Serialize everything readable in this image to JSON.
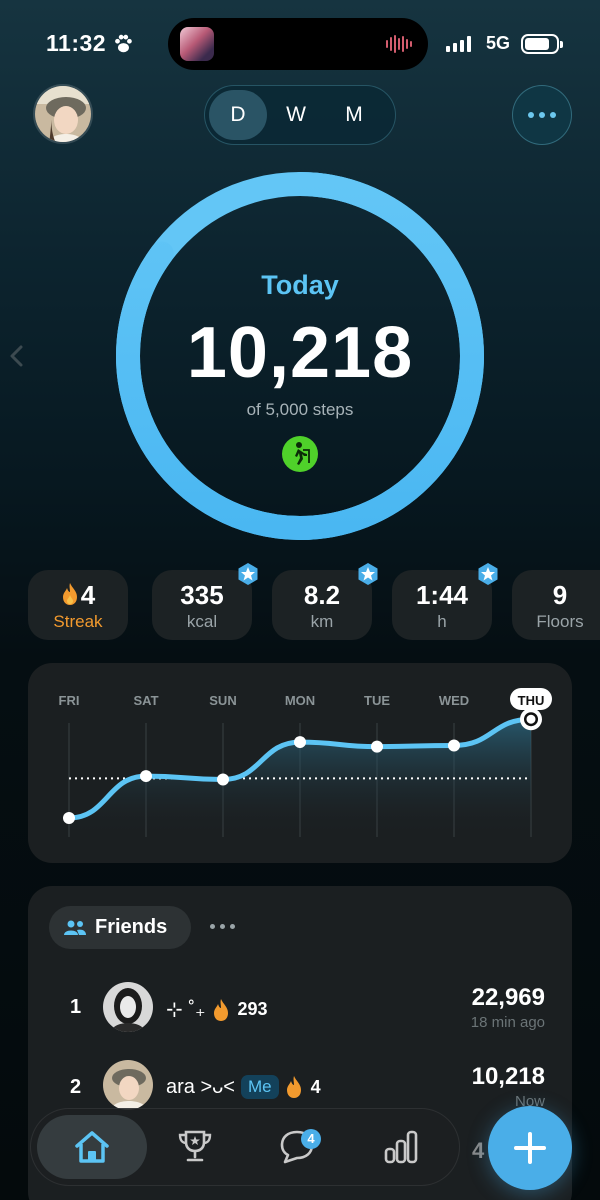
{
  "status": {
    "time": "11:32",
    "network": "5G"
  },
  "header": {
    "segments": [
      "D",
      "W",
      "M"
    ],
    "active_segment": "D"
  },
  "ring": {
    "label": "Today",
    "steps": "10,218",
    "goal": "of 5,000 steps",
    "progress": 1.0
  },
  "stats": [
    {
      "value": "4",
      "label": "Streak",
      "badge": false
    },
    {
      "value": "335",
      "label": "kcal",
      "badge": true
    },
    {
      "value": "8.2",
      "label": "km",
      "badge": true
    },
    {
      "value": "1:44",
      "label": "h",
      "badge": true
    },
    {
      "value": "9",
      "label": "Floors",
      "badge": false
    }
  ],
  "chart_data": {
    "type": "line",
    "categories": [
      "FRI",
      "SAT",
      "SUN",
      "MON",
      "TUE",
      "WED",
      "THU"
    ],
    "highlighted": "THU",
    "values": [
      1500,
      5200,
      4900,
      8200,
      7800,
      7900,
      10218
    ],
    "goal": 5000,
    "ylim": [
      0,
      12000
    ],
    "grid": true,
    "colors": {
      "line": "#5cc4f4",
      "goal_line": "#ffffff"
    }
  },
  "friends": {
    "title": "Friends",
    "rows": [
      {
        "rank": "1",
        "name": "⊹ ˚₊",
        "streak": "293",
        "steps": "22,969",
        "time": "18 min ago",
        "me": false
      },
      {
        "rank": "2",
        "name": "ara >ᴗ<",
        "me_label": "Me",
        "streak": "4",
        "steps": "10,218",
        "time": "Now",
        "me": true
      }
    ],
    "peek_number": "4"
  },
  "tabbar": {
    "chat_badge": "4"
  },
  "icons": [
    "paw-icon",
    "chevron-left-icon",
    "walking-icon",
    "flame-icon",
    "star-badge-icon",
    "friends-icon",
    "home-icon",
    "trophy-icon",
    "chat-icon",
    "stats-icon",
    "plus-icon"
  ]
}
